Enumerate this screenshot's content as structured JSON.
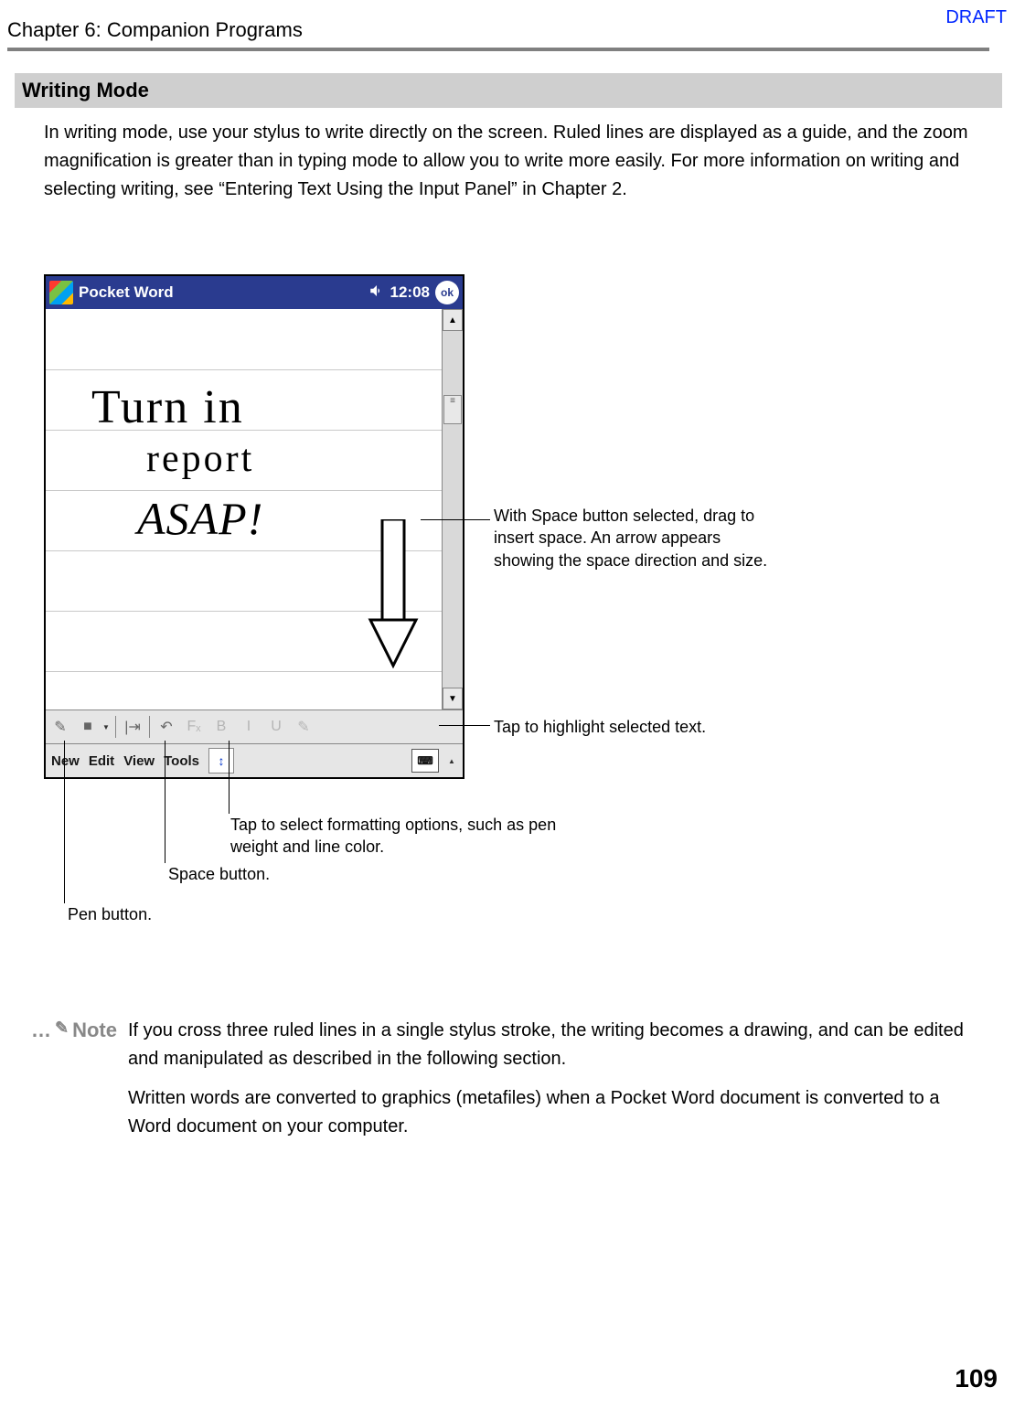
{
  "header": {
    "chapter": "Chapter 6: Companion Programs",
    "draft": "DRAFT"
  },
  "section": {
    "title": "Writing Mode",
    "body": "In writing mode, use your stylus to write directly on the screen. Ruled lines are displayed as a guide, and the zoom magnification is greater than in typing mode to allow you to write more easily. For more information on writing and selecting writing, see “Entering Text Using the Input Panel” in Chapter 2."
  },
  "device": {
    "title": "Pocket Word",
    "time": "12:08",
    "ok": "ok",
    "handwriting": {
      "line1": "Turn in",
      "line2": "report",
      "line3": "ASAP!"
    },
    "toolbar": {
      "pen_glyph": "✎",
      "fill_glyph": "■",
      "space_glyph": "|⇥",
      "undo_glyph": "↶",
      "font_glyph": "Fₓ",
      "bold_glyph": "B",
      "italic_glyph": "I",
      "underline_glyph": "U",
      "highlight_glyph": "✎"
    },
    "menus": {
      "new": "New",
      "edit": "Edit",
      "view": "View",
      "tools": "Tools",
      "sip_glyph": "↕",
      "kb_glyph": "⌨"
    },
    "scroll": {
      "up": "▲",
      "down": "▼"
    }
  },
  "callouts": {
    "space_drag": "With Space button selected, drag to insert space. An arrow appears showing the space direction and size.",
    "highlight": "Tap to highlight selected text.",
    "formatting": "Tap to select formatting options, such as pen weight and line color.",
    "space_btn": "Space button.",
    "pen_btn": "Pen button."
  },
  "note": {
    "label": "Note",
    "p1": "If you cross three ruled lines in a single stylus stroke, the writing becomes a drawing, and can be edited and manipulated as described in the following section.",
    "p2": "Written words are converted to graphics (metafiles) when a Pocket Word document is converted to a Word document on your computer."
  },
  "page_number": "109"
}
